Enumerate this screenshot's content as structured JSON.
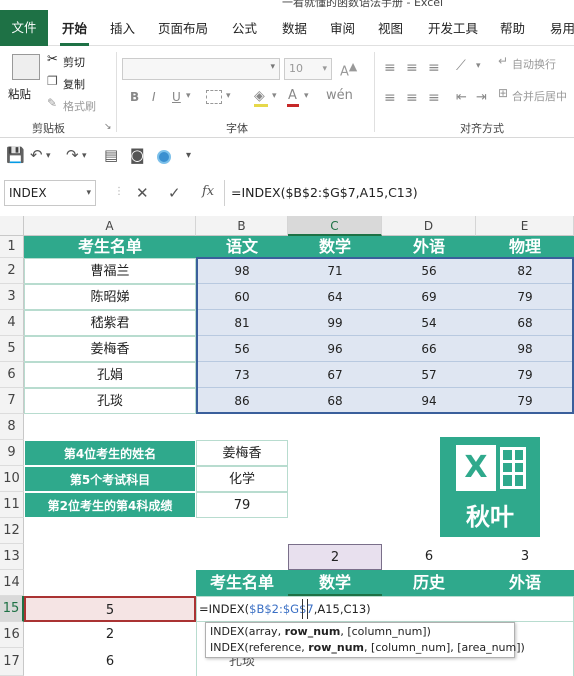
{
  "window": {
    "title": "一看就懂的函数语法手册 - Excel"
  },
  "tabs": [
    "文件",
    "开始",
    "插入",
    "页面布局",
    "公式",
    "数据",
    "审阅",
    "视图",
    "开发工具",
    "帮助",
    "易用"
  ],
  "ribbon": {
    "clipboard": {
      "paste": "粘贴",
      "cut": "剪切",
      "copy": "复制",
      "format_painter": "格式刷",
      "label": "剪贴板"
    },
    "font": {
      "size": "10",
      "label": "字体",
      "bold": "B",
      "italic": "I",
      "underline": "U"
    },
    "alignment": {
      "wrap": "自动换行",
      "merge": "合并后居中",
      "label": "对齐方式"
    }
  },
  "formula_bar": {
    "name_box": "INDEX",
    "formula": "=INDEX($B$2:$G$7,A15,C13)"
  },
  "columns": [
    "A",
    "B",
    "C",
    "D",
    "E"
  ],
  "rows": [
    "1",
    "2",
    "3",
    "4",
    "5",
    "6",
    "7",
    "8",
    "9",
    "10",
    "11",
    "12",
    "13",
    "14",
    "15",
    "16",
    "17"
  ],
  "table1": {
    "headers": [
      "考生名单",
      "语文",
      "数学",
      "外语",
      "物理"
    ],
    "rows": [
      [
        "曹福兰",
        "98",
        "71",
        "56",
        "82"
      ],
      [
        "陈昭娣",
        "60",
        "64",
        "69",
        "79"
      ],
      [
        "嵇紫君",
        "81",
        "99",
        "54",
        "68"
      ],
      [
        "姜梅香",
        "56",
        "96",
        "66",
        "98"
      ],
      [
        "孔娟",
        "73",
        "67",
        "57",
        "79"
      ],
      [
        "孔琰",
        "86",
        "68",
        "94",
        "79"
      ]
    ]
  },
  "questions": [
    {
      "label": "第4位考生的姓名",
      "value": "姜梅香"
    },
    {
      "label": "第5个考试科目",
      "value": "化学"
    },
    {
      "label": "第2位考生的第4科成绩",
      "value": "79"
    }
  ],
  "row13": [
    "2",
    "6",
    "3"
  ],
  "table2": {
    "headers": [
      "考生名单",
      "数学",
      "历史",
      "外语"
    ]
  },
  "col_a": [
    "5",
    "2",
    "6"
  ],
  "editing": {
    "prefix": "=INDEX(",
    "ref": "$B$2:$G$7",
    "suffix": ",A15,C13)"
  },
  "row17_partial": "孔琰",
  "tooltip": {
    "line1": {
      "fn": "INDEX(array, ",
      "bold": "row_num",
      ",rest": ""
    },
    "line1_rest": ", [column_num])",
    "line2_pre": "INDEX(reference, ",
    "line2_bold": "row_num",
    "line2_rest": ", [column_num], [area_num])"
  },
  "logo": {
    "text": "秋叶",
    "letter": "X"
  },
  "colors": {
    "accent": "#2fa98c",
    "excel_green": "#1e7145",
    "blue_fill": "#dfe6f2"
  }
}
